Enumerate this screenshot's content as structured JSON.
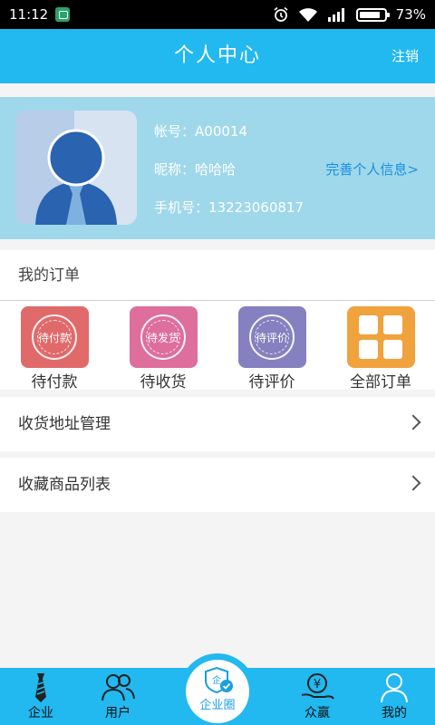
{
  "statusbar": {
    "time": "11:12",
    "battery": "73%"
  },
  "appbar": {
    "title": "个人中心",
    "logout": "注销"
  },
  "profile": {
    "account_label": "帐号：",
    "account_value": "A00014",
    "nickname_label": "昵称：",
    "nickname_value": "哈哈哈",
    "phone_label": "手机号：",
    "phone_value": "13223060817",
    "complete_link": "完善个人信息>"
  },
  "orders": {
    "title": "我的订单",
    "items": [
      {
        "label": "待付款",
        "stamp": "待付款",
        "color": "#e06a6a"
      },
      {
        "label": "待收货",
        "stamp": "待发货",
        "color": "#de6e9c"
      },
      {
        "label": "待评价",
        "stamp": "待评价",
        "color": "#8580bf"
      },
      {
        "label": "全部订单",
        "color": "#f0a23c"
      }
    ]
  },
  "menu": {
    "address": "收货地址管理",
    "favorites": "收藏商品列表"
  },
  "bottomnav": {
    "items": [
      {
        "label": "企业",
        "icon": "tie-icon"
      },
      {
        "label": "用户",
        "icon": "users-icon"
      },
      {
        "label": "企业圈",
        "icon": "enterprise-circle-icon"
      },
      {
        "label": "众赢",
        "icon": "money-hand-icon"
      },
      {
        "label": "我的",
        "icon": "person-icon"
      }
    ]
  }
}
